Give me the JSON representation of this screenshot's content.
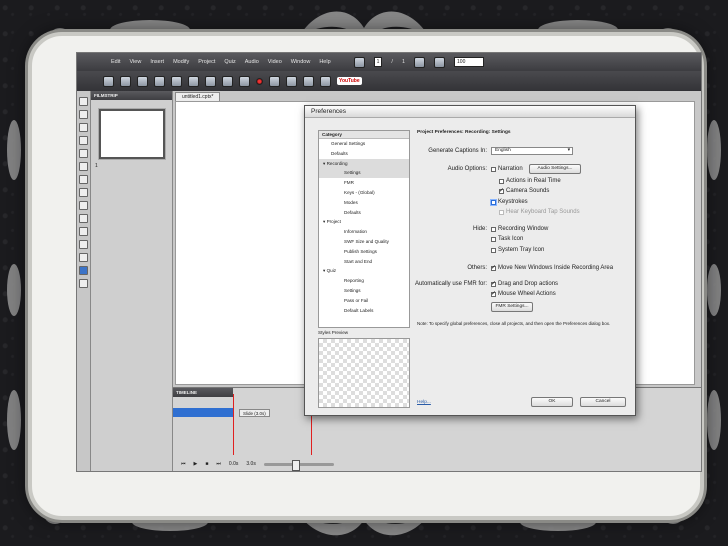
{
  "app": {
    "menu": [
      "Edit",
      "View",
      "Insert",
      "Modify",
      "Project",
      "Quiz",
      "Audio",
      "Video",
      "Window",
      "Help"
    ],
    "toolbar": {
      "youtube_label": "YouTube",
      "slide_current": "1",
      "slide_sep": "/",
      "slide_total": "1",
      "zoom": "100"
    },
    "filmstrip": {
      "title": "FILMSTRIP",
      "slide_number": "1"
    },
    "document_tab": "untitled1.cptx*",
    "timeline": {
      "title": "TIMELINE",
      "slide_label": "Slide (3.0s)",
      "time_start": "0.0s",
      "time_end": "3.0s"
    }
  },
  "dialog": {
    "title": "Preferences",
    "category_header": "Category",
    "categories": [
      {
        "label": "General Settings",
        "level": 1
      },
      {
        "label": "Defaults",
        "level": 1
      },
      {
        "label": "▾  Recording",
        "level": 0,
        "selected": true
      },
      {
        "label": "Settings",
        "level": 2,
        "selected": true
      },
      {
        "label": "FMR",
        "level": 2
      },
      {
        "label": "Keys - (Global)",
        "level": 2
      },
      {
        "label": "Modes",
        "level": 2
      },
      {
        "label": "Defaults",
        "level": 2
      },
      {
        "label": "▾  Project",
        "level": 0
      },
      {
        "label": "Information",
        "level": 2
      },
      {
        "label": "SWF Size and Quality",
        "level": 2
      },
      {
        "label": "Publish Settings",
        "level": 2
      },
      {
        "label": "Start and End",
        "level": 2
      },
      {
        "label": "▾  Quiz",
        "level": 0
      },
      {
        "label": "Reporting",
        "level": 2
      },
      {
        "label": "Settings",
        "level": 2
      },
      {
        "label": "Pass or Fail",
        "level": 2
      },
      {
        "label": "Default Labels",
        "level": 2
      }
    ],
    "styles_preview_label": "Styles Preview",
    "section_title": "Project Preferences: Recording: Settings",
    "generate_captions_label": "Generate Captions In:",
    "generate_captions_value": "English",
    "audio_options_label": "Audio Options:",
    "narration": "Narration",
    "audio_settings_button": "Audio Settings...",
    "actions_real_time": "Actions in Real Time",
    "camera_sounds": "Camera Sounds",
    "keystrokes": "Keystrokes",
    "hear_keyboard": "Hear Keyboard Tap Sounds",
    "hide_label": "Hide:",
    "recording_window": "Recording Window",
    "task_icon": "Task Icon",
    "system_tray_icon": "System Tray Icon",
    "others_label": "Others:",
    "move_new_windows": "Move New Windows Inside Recording Area",
    "auto_fmr_label": "Automatically use FMR for:",
    "drag_drop": "Drag and Drop actions",
    "mouse_wheel": "Mouse Wheel Actions",
    "fmr_settings_button": "FMR Settings...",
    "note": "Note: To specify global preferences, close all projects, and then open the Preferences dialog box.",
    "help_link": "Help...",
    "ok_button": "OK",
    "cancel_button": "Cancel"
  }
}
